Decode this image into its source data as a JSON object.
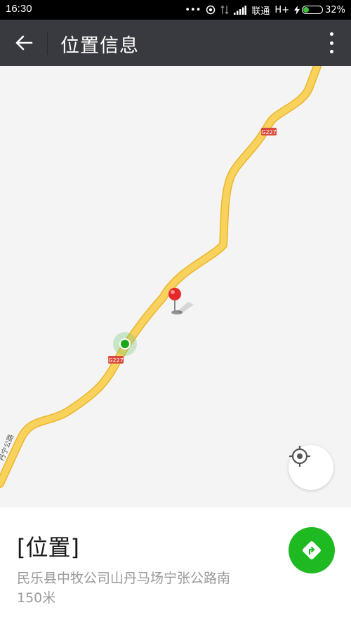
{
  "status_bar": {
    "time": "16:30",
    "dots": "•••",
    "carrier": "联通",
    "network": "H+",
    "battery_percent": "32%",
    "battery_level": 0.32,
    "battery_color": "#3cc03c"
  },
  "app_bar": {
    "title": "位置信息",
    "back_icon": "arrow-left-icon",
    "more_icon": "more-vertical-icon",
    "background": "#393a3f"
  },
  "map": {
    "road_labels": [
      "G227",
      "G227",
      "丹宁公路"
    ],
    "road_color": "#f5c842",
    "background": "#f4f4f4",
    "user_location_icon": "green-dot-icon",
    "pin_icon": "red-map-pin-icon",
    "locate_icon": "crosshair-icon"
  },
  "location": {
    "title": "[位置]",
    "address": "民乐县中牧公司山丹马场宁张公路南",
    "distance": "150米",
    "navigate_icon": "navigation-diamond-icon",
    "accent": "#1fb922"
  }
}
